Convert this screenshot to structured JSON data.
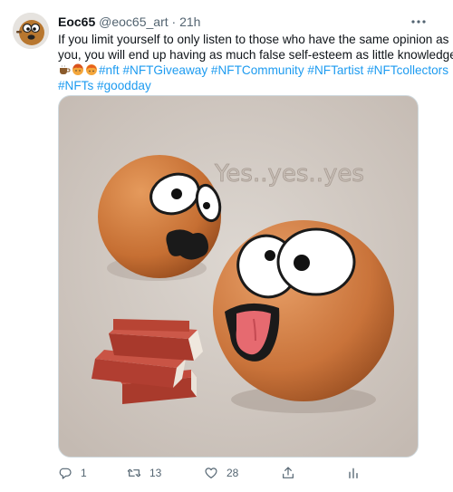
{
  "author": {
    "name": "Eoc65",
    "handle": "@eoc65_art",
    "separator": "·",
    "time": "21h"
  },
  "tweet": {
    "line1": "If you limit yourself to only listen to those who have the same opinion as",
    "line2": "you, you will end up having as much false self-esteem as little knowledge.",
    "hashtags_line3": "#nft #NFTGiveaway #NFTCommunity #NFTartist #NFTcollectors",
    "hashtags_line4": "#NFTs  #goodday"
  },
  "media": {
    "overlay_text": "Yes..yes..yes"
  },
  "actions": {
    "reply_count": "1",
    "retweet_count": "13",
    "like_count": "28"
  },
  "icons": {
    "more": "more-icon",
    "reply": "reply-icon",
    "retweet": "retweet-icon",
    "like": "heart-icon",
    "share": "share-icon",
    "analytics": "analytics-icon"
  },
  "colors": {
    "link": "#1d9bf0",
    "muted": "#536471",
    "text": "#0f1419"
  }
}
